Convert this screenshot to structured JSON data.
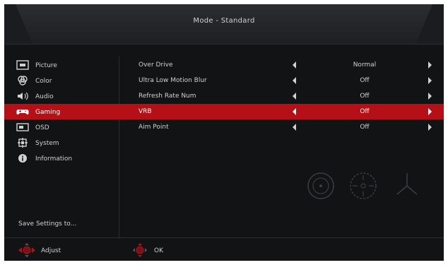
{
  "header": {
    "title": "Mode - Standard"
  },
  "sidebar": {
    "items": [
      {
        "label": "Picture",
        "icon": "picture-icon",
        "active": false
      },
      {
        "label": "Color",
        "icon": "color-icon",
        "active": false
      },
      {
        "label": "Audio",
        "icon": "audio-icon",
        "active": false
      },
      {
        "label": "Gaming",
        "icon": "gaming-icon",
        "active": true
      },
      {
        "label": "OSD",
        "icon": "osd-icon",
        "active": false
      },
      {
        "label": "System",
        "icon": "system-icon",
        "active": false
      },
      {
        "label": "Information",
        "icon": "information-icon",
        "active": false
      }
    ],
    "footer": "Save Settings to..."
  },
  "settings": {
    "rows": [
      {
        "label": "Over Drive",
        "value": "Normal",
        "active": false
      },
      {
        "label": "Ultra Low Motion Blur",
        "value": "Off",
        "active": false
      },
      {
        "label": "Refresh Rate Num",
        "value": "Off",
        "active": false
      },
      {
        "label": "VRB",
        "value": "Off",
        "active": true
      },
      {
        "label": "Aim Point",
        "value": "Off",
        "active": false
      }
    ]
  },
  "footer": {
    "adjust_label": "Adjust",
    "ok_label": "OK"
  },
  "colors": {
    "accent": "#b50f17",
    "background": "#111315",
    "text": "#cfd1d3"
  }
}
